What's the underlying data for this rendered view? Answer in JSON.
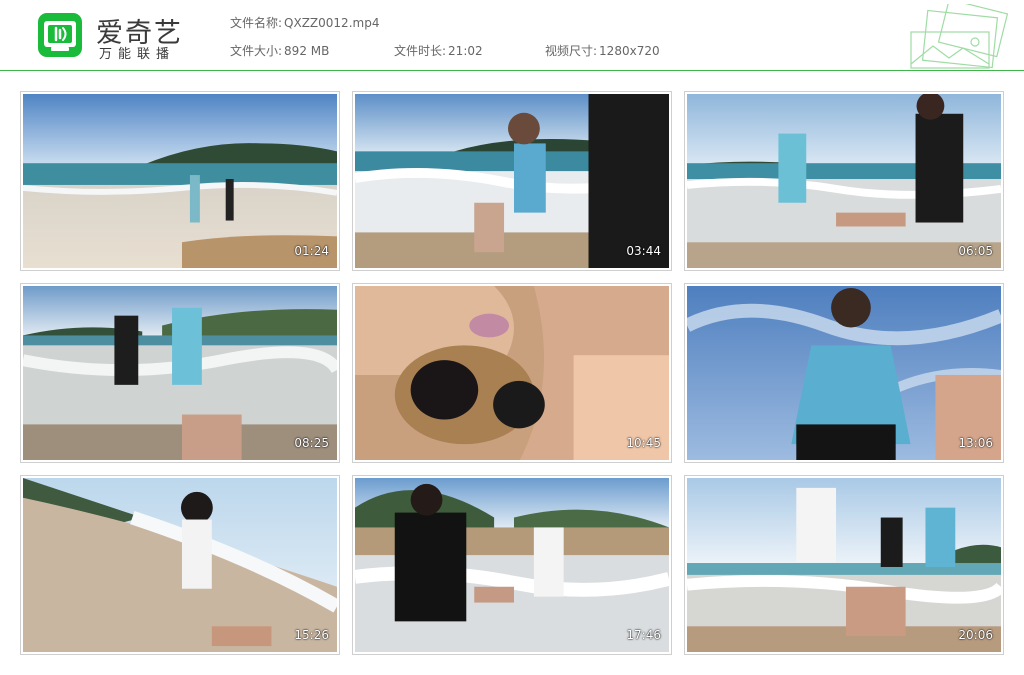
{
  "brand": {
    "name": "爱奇艺",
    "slogan": "万能联播",
    "accent": "#1aba3b"
  },
  "file": {
    "name_label": "文件名称:",
    "name_value": "QXZZ0012.mp4",
    "size_label": "文件大小:",
    "size_value": "892 MB",
    "duration_label": "文件时长:",
    "duration_value": "21:02",
    "resolution_label": "视频尺寸:",
    "resolution_value": "1280x720"
  },
  "thumbnails": [
    {
      "time": "01:24",
      "scene": "beach-wide"
    },
    {
      "time": "03:44",
      "scene": "beach-waves"
    },
    {
      "time": "06:05",
      "scene": "beach-jump"
    },
    {
      "time": "08:25",
      "scene": "beach-shore"
    },
    {
      "time": "10:45",
      "scene": "closeup-sunglasses"
    },
    {
      "time": "13:06",
      "scene": "low-angle-sky"
    },
    {
      "time": "15:26",
      "scene": "sand-lowangle"
    },
    {
      "time": "17:46",
      "scene": "surf-group"
    },
    {
      "time": "20:06",
      "scene": "surf-closeup"
    }
  ]
}
